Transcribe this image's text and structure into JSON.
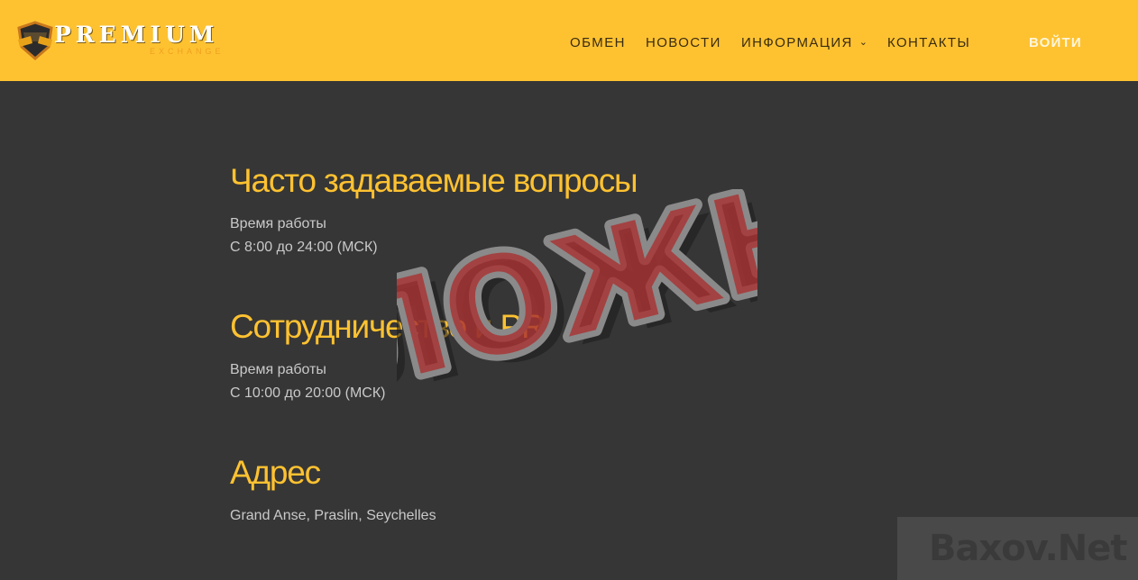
{
  "header": {
    "logo_word": "PREMIUM",
    "logo_sub": "EXCHANGE",
    "nav": [
      {
        "label": "ОБМЕН"
      },
      {
        "label": "НОВОСТИ"
      },
      {
        "label": "ИНФОРМАЦИЯ",
        "has_dropdown": true
      },
      {
        "label": "КОНТАКТЫ"
      }
    ],
    "login_label": "ВОЙТИ"
  },
  "sections": [
    {
      "title": "Часто задаваемые вопросы",
      "lines": [
        "Время работы",
        "С 8:00 до 24:00 (МСК)"
      ]
    },
    {
      "title": "Сотрудничество и PR",
      "lines": [
        "Время работы",
        "С 10:00 до 20:00 (МСК)"
      ]
    },
    {
      "title": "Адрес",
      "lines": [
        "Grand Anse, Praslin, Seychelles"
      ]
    }
  ],
  "stamp_text": "ЛОЖЬ",
  "watermark": "Baxov.Net",
  "colors": {
    "accent": "#fec231",
    "background": "#363636",
    "stamp": "#a83232"
  }
}
